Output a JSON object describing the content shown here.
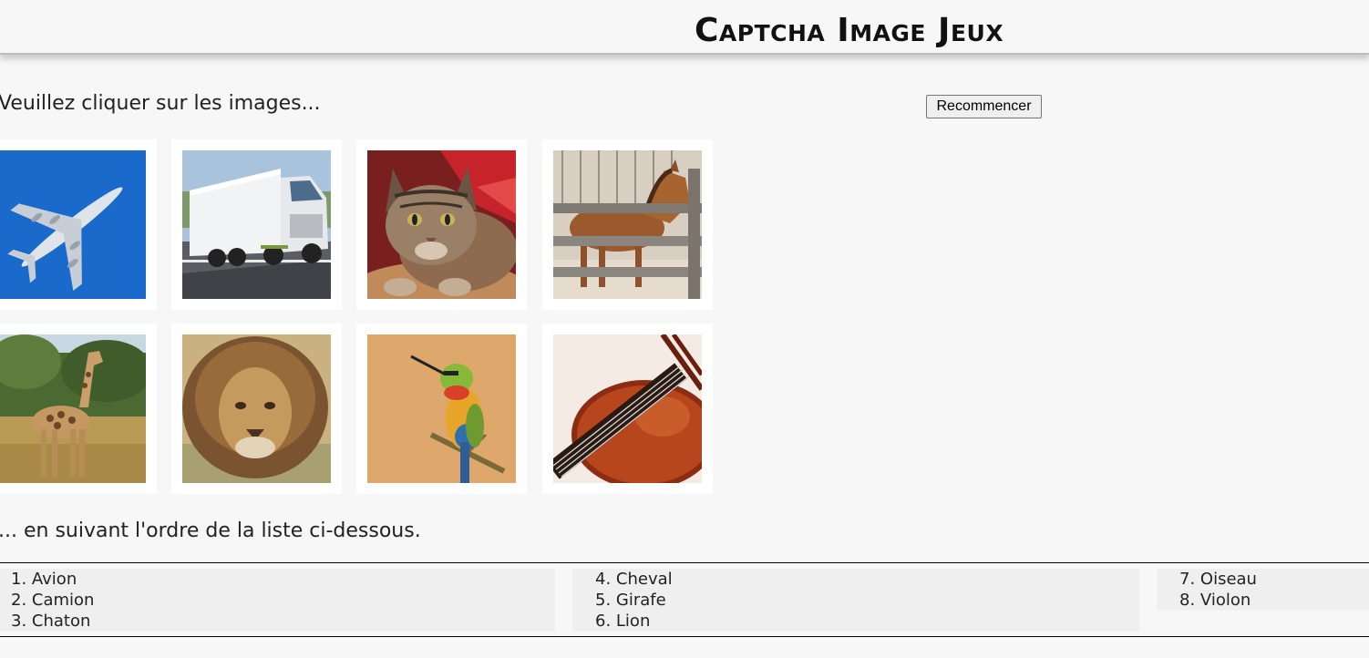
{
  "header": {
    "title": "Captcha Image Jeux"
  },
  "instructions": {
    "top": "Veuillez cliquer sur les images...",
    "bottom": "... en suivant l'ordre de la liste ci-dessous."
  },
  "controls": {
    "restart_label": "Recommencer"
  },
  "images": [
    {
      "subject": "airplane"
    },
    {
      "subject": "truck"
    },
    {
      "subject": "cat"
    },
    {
      "subject": "horse"
    },
    {
      "subject": "giraffe"
    },
    {
      "subject": "lion"
    },
    {
      "subject": "bird"
    },
    {
      "subject": "violin"
    }
  ],
  "order_list": [
    [
      "1. Avion",
      "2. Camion",
      "3. Chaton"
    ],
    [
      "4. Cheval",
      "5. Girafe",
      "6. Lion"
    ],
    [
      "7. Oiseau",
      "8. Violon"
    ]
  ],
  "colors": {
    "background": "#f7f7f7",
    "tile": "#ffffff",
    "list_column": "#efefef"
  }
}
